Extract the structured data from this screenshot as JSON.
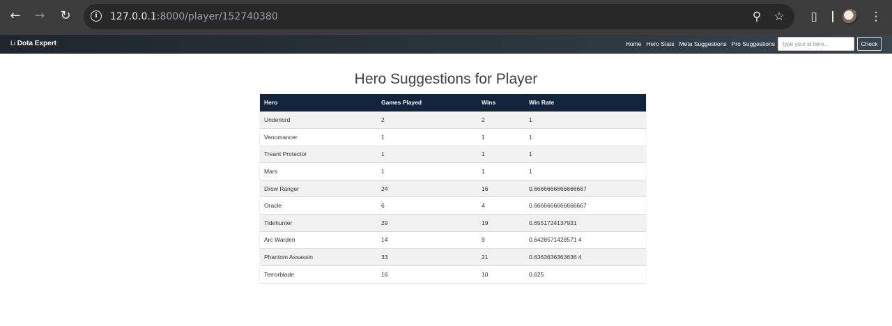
{
  "browser": {
    "url_host": "127.0.0.1",
    "url_path": ":8000/player/152740380"
  },
  "site": {
    "brand_broken_alt": "Li",
    "brand_name": "Dota Expert",
    "nav": {
      "home": "Home",
      "hero_stats": "Hero Stats",
      "meta_suggestions": "Meta Suggestions",
      "pro_suggestions": "Pro Suggestions"
    },
    "search_placeholder": "type your id here...",
    "check_label": "Check"
  },
  "page": {
    "title": "Hero Suggestions for Player"
  },
  "table": {
    "headers": {
      "hero": "Hero",
      "games_played": "Games Played",
      "wins": "Wins",
      "win_rate": "Win Rate"
    },
    "rows": [
      {
        "hero": "Underlord",
        "games": "2",
        "wins": "2",
        "win_rate": "1"
      },
      {
        "hero": "Venomancer",
        "games": "1",
        "wins": "1",
        "win_rate": "1"
      },
      {
        "hero": "Treant Protector",
        "games": "1",
        "wins": "1",
        "win_rate": "1"
      },
      {
        "hero": "Mars",
        "games": "1",
        "wins": "1",
        "win_rate": "1"
      },
      {
        "hero": "Drow Ranger",
        "games": "24",
        "wins": "16",
        "win_rate": "0.6666666666666667"
      },
      {
        "hero": "Oracle",
        "games": "6",
        "wins": "4",
        "win_rate": "0.6666666666666667"
      },
      {
        "hero": "Tidehunter",
        "games": "29",
        "wins": "19",
        "win_rate": "0.6551724137931"
      },
      {
        "hero": "Arc Warden",
        "games": "14",
        "wins": "9",
        "win_rate": "0.6428571428571 4"
      },
      {
        "hero": "Phantom Assassin",
        "games": "33",
        "wins": "21",
        "win_rate": "0.6363636363636 4"
      },
      {
        "hero": "Terrorblade",
        "games": "16",
        "wins": "10",
        "win_rate": "0.625"
      }
    ]
  }
}
